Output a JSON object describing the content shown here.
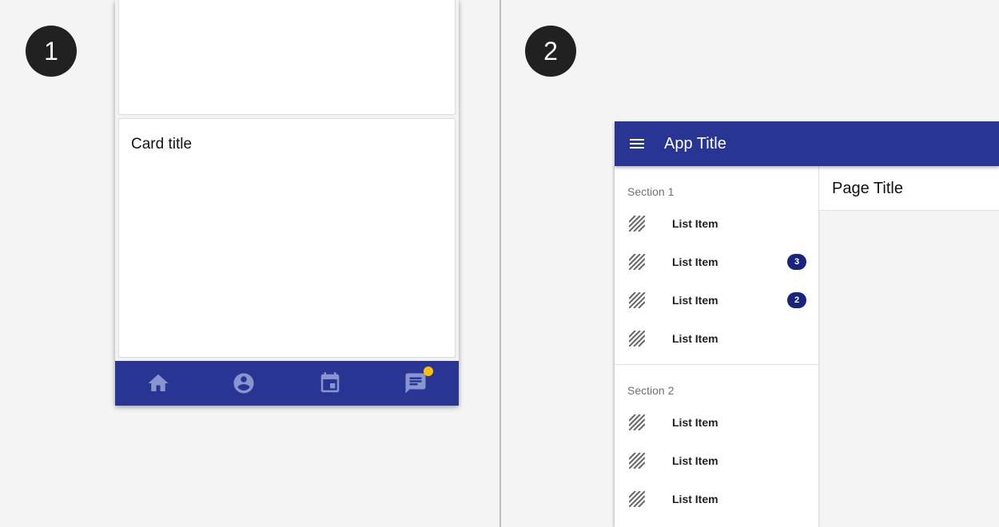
{
  "steps": {
    "one": "1",
    "two": "2"
  },
  "panel1": {
    "card_title": "Card title",
    "bottom_nav": [
      {
        "icon": "home-icon"
      },
      {
        "icon": "account-circle-icon"
      },
      {
        "icon": "calendar-icon"
      },
      {
        "icon": "chat-icon",
        "has_badge": true
      }
    ],
    "colors": {
      "nav_bg": "#283593",
      "nav_icon": "#8a95cf",
      "badge": "#ffc107"
    }
  },
  "panel2": {
    "app_title": "App Title",
    "page_title": "Page Title",
    "sections": [
      {
        "label": "Section 1",
        "items": [
          {
            "label": "List Item",
            "count": ""
          },
          {
            "label": "List Item",
            "count": "3"
          },
          {
            "label": "List Item",
            "count": "2"
          },
          {
            "label": "List Item",
            "count": ""
          }
        ]
      },
      {
        "label": "Section 2",
        "items": [
          {
            "label": "List Item",
            "count": ""
          },
          {
            "label": "List Item",
            "count": ""
          },
          {
            "label": "List Item",
            "count": ""
          }
        ]
      }
    ],
    "colors": {
      "app_bar": "#283593",
      "count_badge": "#1a237e"
    }
  }
}
